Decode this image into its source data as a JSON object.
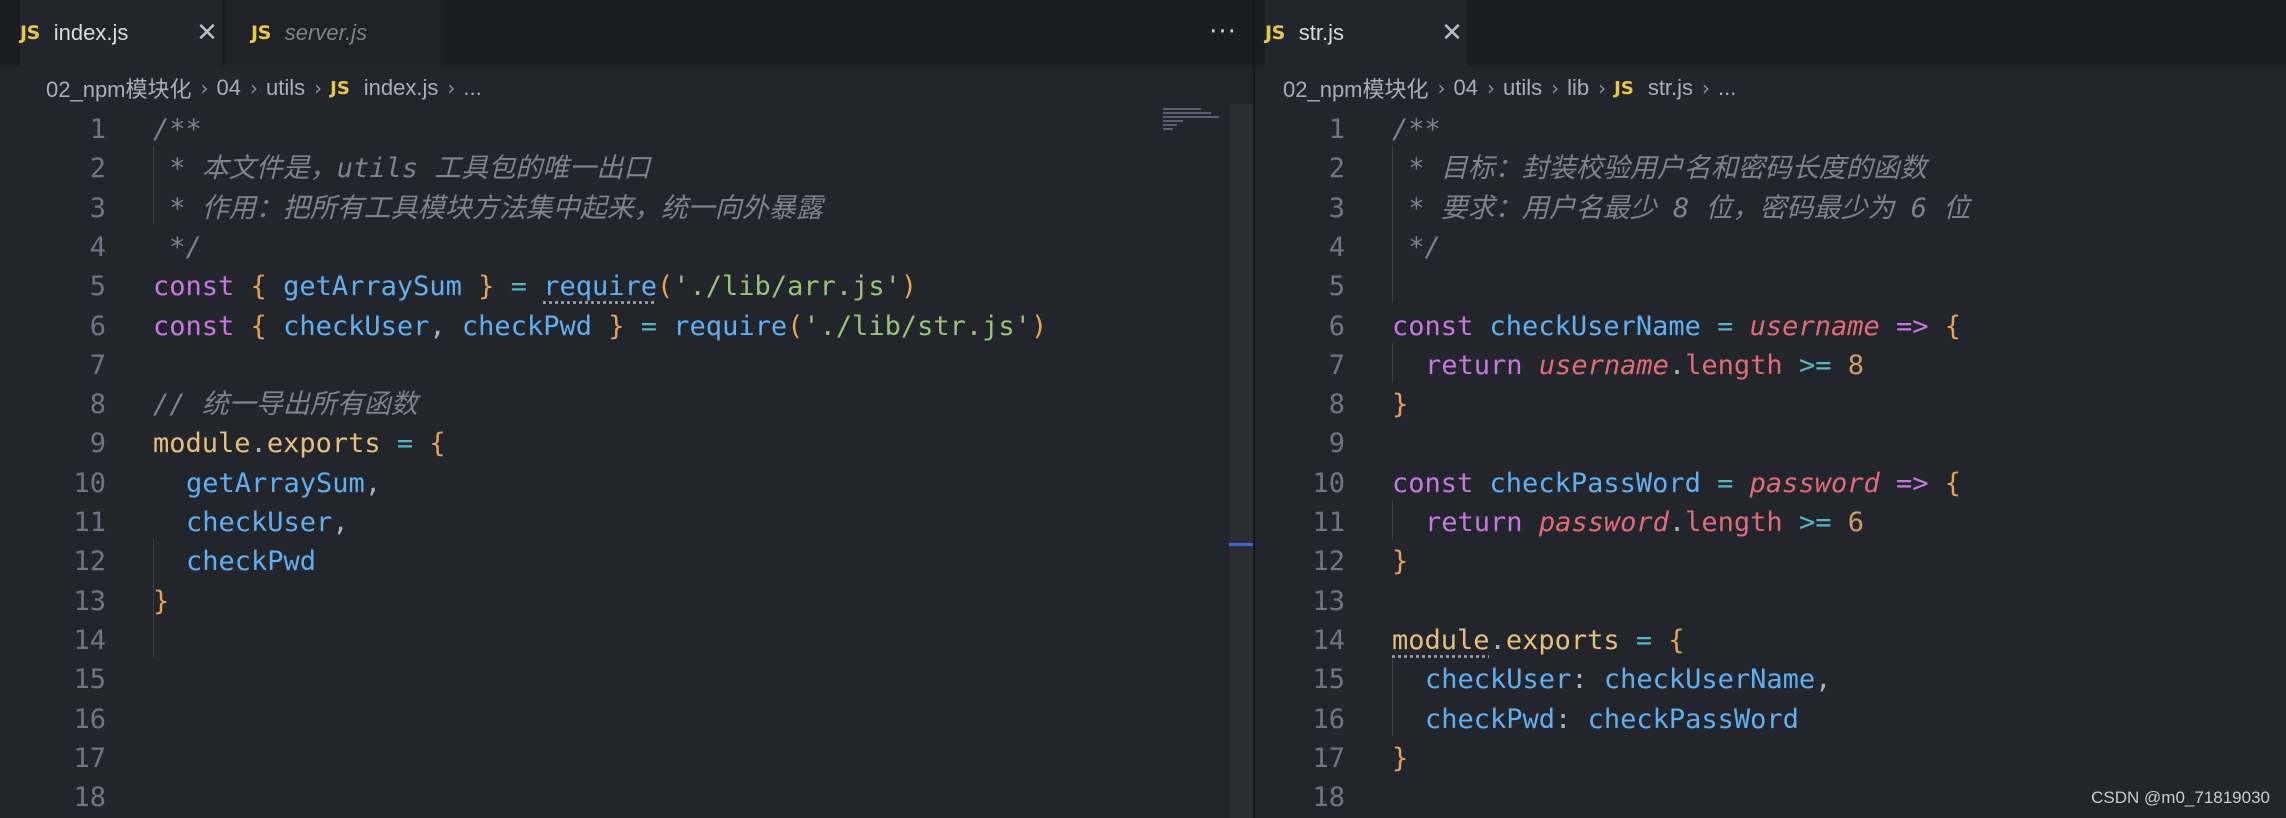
{
  "left_editor": {
    "tabs": [
      {
        "label": "index.js",
        "badge": "JS",
        "active": true
      },
      {
        "label": "server.js",
        "badge": "JS",
        "active": false
      }
    ],
    "more_actions": "···",
    "breadcrumb": [
      "02_npm模块化",
      "04",
      "utils",
      "index.js",
      "..."
    ],
    "breadcrumb_badge": "JS"
  },
  "right_editor": {
    "tabs": [
      {
        "label": "str.js",
        "badge": "JS",
        "active": true
      }
    ],
    "breadcrumb": [
      "02_npm模块化",
      "04",
      "utils",
      "lib",
      "str.js",
      "..."
    ],
    "breadcrumb_badge": "JS"
  },
  "left_code": {
    "line_numbers": [
      "1",
      "2",
      "3",
      "4",
      "5",
      "6",
      "7",
      "8",
      "9",
      "10",
      "11",
      "12",
      "13",
      "14",
      "15",
      "16",
      "17",
      "18"
    ],
    "l1": "/**",
    "l2": " * 本文件是，utils 工具包的唯一出口",
    "l3": " * 作用：把所有工具模块方法集中起来，统一向外暴露",
    "l4": " */",
    "l5": {
      "kw": "const",
      "ob": "{",
      "name": "getArraySum",
      "cb": "}",
      "eq": "=",
      "fn": "require",
      "lp": "(",
      "str": "'./lib/arr.js'",
      "rp": ")"
    },
    "l6": {
      "kw": "const",
      "ob": "{",
      "name1": "checkUser",
      "comma": ",",
      "name2": "checkPwd",
      "cb": "}",
      "eq": "=",
      "fn": "require",
      "lp": "(",
      "str": "'./lib/str.js'",
      "rp": ")"
    },
    "l8": "// 统一导出所有函数",
    "l9": {
      "obj": "module",
      "dot": ".",
      "prop": "exports",
      "eq": "=",
      "ob": "{"
    },
    "l10": "getArraySum",
    "l10_comma": ",",
    "l11": "checkUser",
    "l11_comma": ",",
    "l12": "checkPwd",
    "l13": "}"
  },
  "right_code": {
    "line_numbers": [
      "1",
      "2",
      "3",
      "4",
      "5",
      "6",
      "7",
      "8",
      "9",
      "10",
      "11",
      "12",
      "13",
      "14",
      "15",
      "16",
      "17",
      "18"
    ],
    "l1": "/**",
    "l2": " * 目标：封装校验用户名和密码长度的函数",
    "l3": " * 要求：用户名最少 8 位，密码最少为 6 位",
    "l4": " */",
    "l6": {
      "kw": "const",
      "name": "checkUserName",
      "eq": "=",
      "param": "username",
      "arrow": "=>",
      "ob": "{"
    },
    "l7": {
      "kw": "return",
      "param": "username",
      "dot": ".",
      "prop": "length",
      "op": ">=",
      "num": "8"
    },
    "l8": "}",
    "l10": {
      "kw": "const",
      "name": "checkPassWord",
      "eq": "=",
      "param": "password",
      "arrow": "=>",
      "ob": "{"
    },
    "l11": {
      "kw": "return",
      "param": "password",
      "dot": ".",
      "prop": "length",
      "op": ">=",
      "num": "6"
    },
    "l12": "}",
    "l14": {
      "obj": "module",
      "dot": ".",
      "prop": "exports",
      "eq": "=",
      "ob": "{"
    },
    "l15": {
      "key": "checkUser",
      "colon": ":",
      "val": "checkUserName",
      "comma": ","
    },
    "l16": {
      "key": "checkPwd",
      "colon": ":",
      "val": "checkPassWord"
    },
    "l17": "}"
  },
  "watermark": "CSDN @m0_71819030"
}
